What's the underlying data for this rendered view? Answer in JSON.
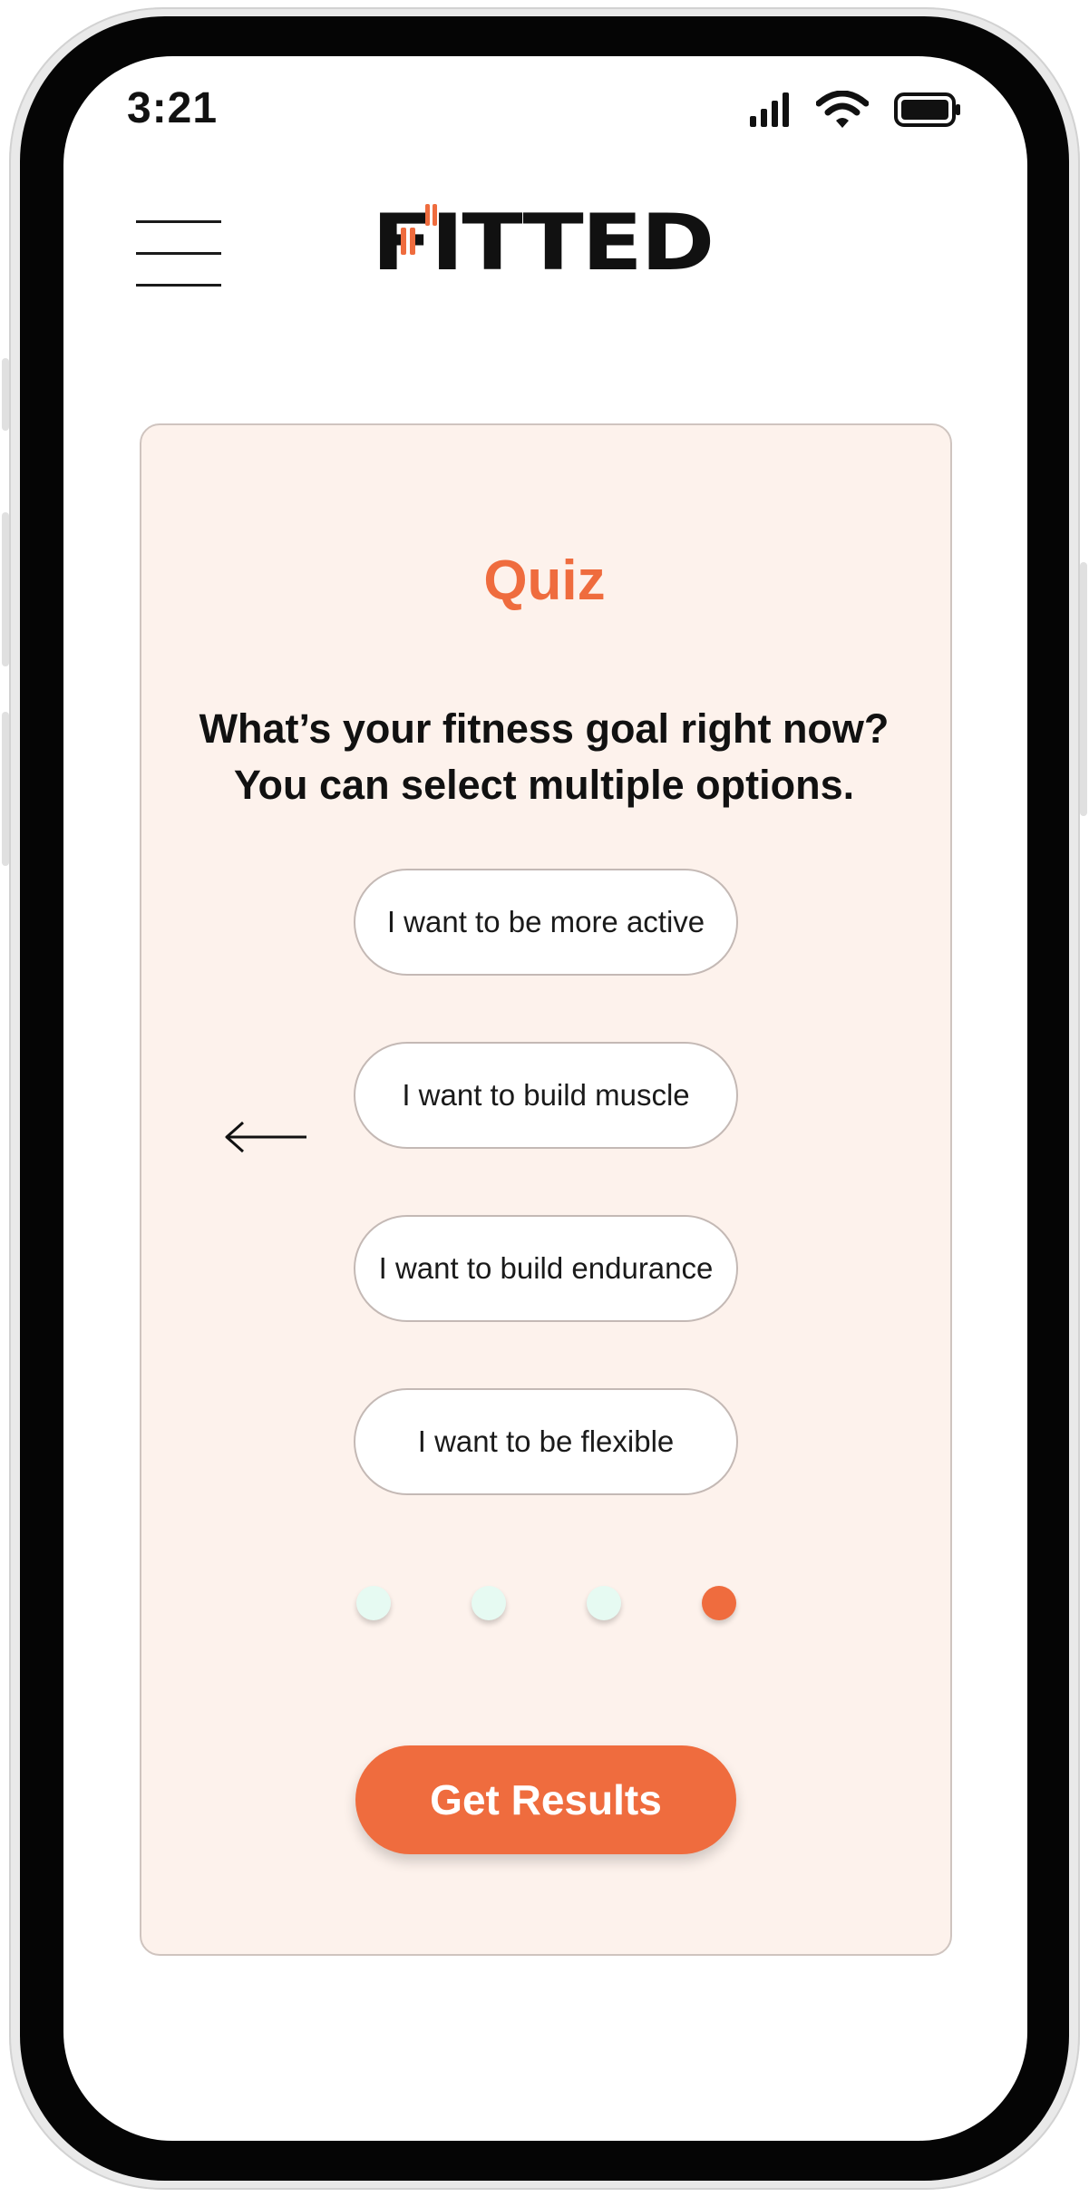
{
  "status_bar": {
    "time": "3:21",
    "icons": [
      "signal-icon",
      "wifi-icon",
      "battery-icon"
    ]
  },
  "header": {
    "menu_icon": "hamburger-menu-icon",
    "logo_text": "FITTED"
  },
  "quiz": {
    "title": "Quiz",
    "question_line1": "What’s your fitness goal right now?",
    "question_line2": "You can select multiple options.",
    "options": [
      "I want to be more active",
      "I want to build muscle",
      "I want to build endurance",
      "I want to be flexible"
    ],
    "back_icon": "arrow-left-icon",
    "progress": {
      "total_steps": 4,
      "current_step": 4
    },
    "cta_label": "Get Results"
  },
  "colors": {
    "accent": "#ef6c3e",
    "card_background": "#fdf2ec",
    "dot_inactive": "#e6faf2",
    "dot_active": "#ef6c3e"
  }
}
